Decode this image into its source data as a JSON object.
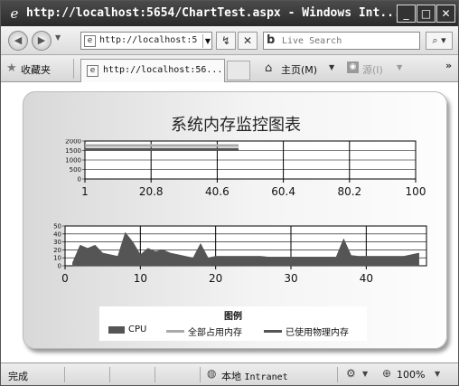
{
  "window": {
    "title": "http://localhost:5654/ChartTest.aspx - Windows Int...",
    "minimize": "_",
    "maximize": "□",
    "close": "✕"
  },
  "address_bar": {
    "url": "http://localhost:5",
    "back_icon": "back-arrow-icon",
    "forward_icon": "forward-arrow-icon",
    "refresh_glyph": "↯",
    "stop_glyph": "✕",
    "search_placeholder": "Live Search",
    "search_logo": "b",
    "search_go_glyph": "⌕ ▾"
  },
  "tab_bar": {
    "favorites_label": "收藏夹",
    "tab_label": "http://localhost:56...",
    "home_label": "主页(M)",
    "feeds_label": "源(I)",
    "overflow": "»"
  },
  "chart": {
    "title": "系统内存监控图表"
  },
  "legend": {
    "title": "图例",
    "items": [
      "CPU",
      "全部占用内存",
      "已使用物理内存"
    ]
  },
  "status_bar": {
    "status": "完成",
    "zone_prefix": "本地 ",
    "zone_latin": "Intranet",
    "zoom": "100%"
  },
  "colors": {
    "cpu": "#555555",
    "total_memory": "#aaaaaa",
    "used_memory": "#555555"
  },
  "chart_data": [
    {
      "type": "line",
      "title": "系统内存监控图表",
      "x_ticks": [
        "1",
        "20.8",
        "40.6",
        "60.4",
        "80.2",
        "100"
      ],
      "y_ticks": [
        "2000",
        "1500",
        "1000",
        "500",
        "0"
      ],
      "ylim": [
        0,
        2000
      ],
      "xlim": [
        1,
        100
      ],
      "grid": true,
      "series": [
        {
          "name": "全部占用内存",
          "x": [
            1,
            47
          ],
          "values": [
            1760,
            1760
          ]
        },
        {
          "name": "已使用物理内存",
          "x": [
            1,
            47
          ],
          "values": [
            1560,
            1560
          ]
        }
      ]
    },
    {
      "type": "area",
      "x_ticks": [
        "0",
        "10",
        "20",
        "30",
        "40"
      ],
      "y_ticks": [
        "50",
        "40",
        "30",
        "20",
        "10",
        "0"
      ],
      "ylim": [
        0,
        50
      ],
      "xlim": [
        0,
        48
      ],
      "grid": true,
      "series": [
        {
          "name": "CPU",
          "x": [
            1,
            2,
            3,
            4,
            5,
            6,
            7,
            8,
            9,
            10,
            11,
            12,
            13,
            14,
            15,
            16,
            17,
            18,
            19,
            20,
            21,
            22,
            23,
            24,
            25,
            26,
            27,
            28,
            29,
            30,
            31,
            32,
            33,
            34,
            35,
            36,
            37,
            38,
            39,
            40,
            41,
            42,
            43,
            44,
            45,
            46,
            47
          ],
          "values": [
            4,
            26,
            22,
            26,
            16,
            14,
            12,
            42,
            30,
            14,
            22,
            18,
            20,
            16,
            14,
            12,
            10,
            28,
            10,
            12,
            12,
            12,
            12,
            12,
            12,
            12,
            11,
            11,
            11,
            11,
            11,
            11,
            11,
            11,
            11,
            11,
            34,
            13,
            12,
            12,
            12,
            12,
            12,
            12,
            12,
            14,
            16
          ]
        }
      ]
    }
  ]
}
